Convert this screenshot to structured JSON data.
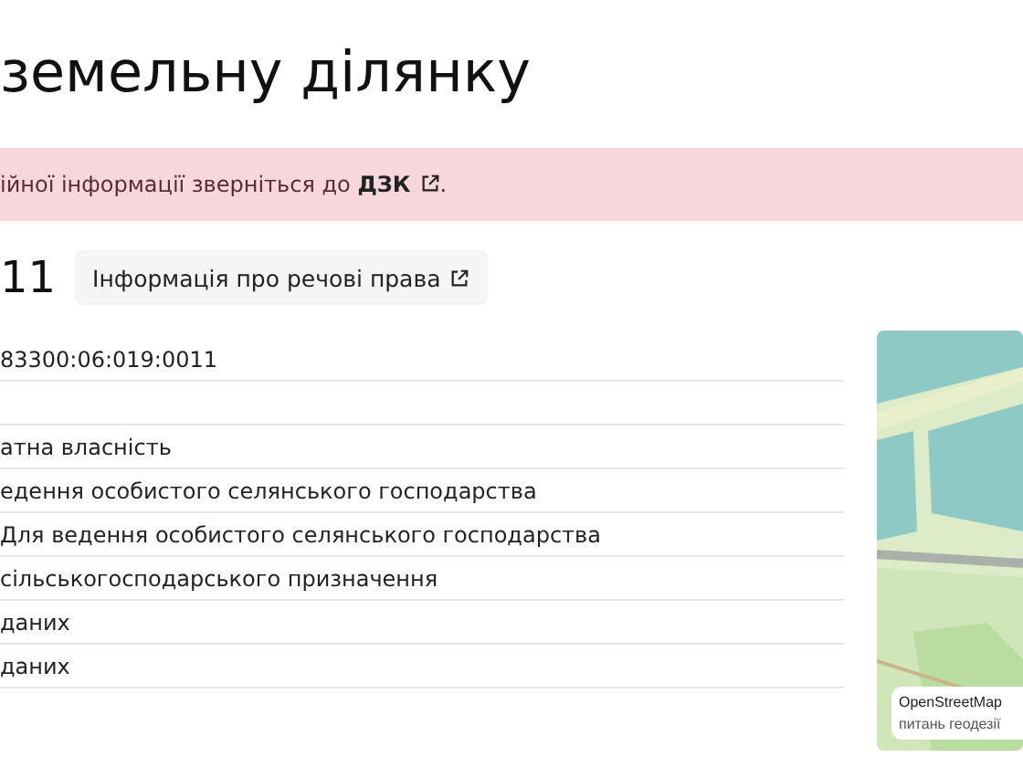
{
  "title": "земельну ділянку",
  "alert": {
    "text": "ійної інформації зверніться до ",
    "link": "ДЗК",
    "end": "."
  },
  "parcel": {
    "number": "11",
    "rights_button": "Інформація про речові права"
  },
  "rows": [
    {
      "value": "83300:06:019:0011"
    },
    {
      "value": ""
    },
    {
      "value": "атна власність"
    },
    {
      "value": "едення особистого селянського господарства"
    },
    {
      "value": "Для ведення особистого селянського господарства"
    },
    {
      "value": "сільськогосподарського призначення"
    },
    {
      "value": "даних"
    },
    {
      "value": "даних"
    }
  ],
  "map": {
    "attribution": [
      "OpenStreetMap",
      "питань геодезії"
    ]
  }
}
